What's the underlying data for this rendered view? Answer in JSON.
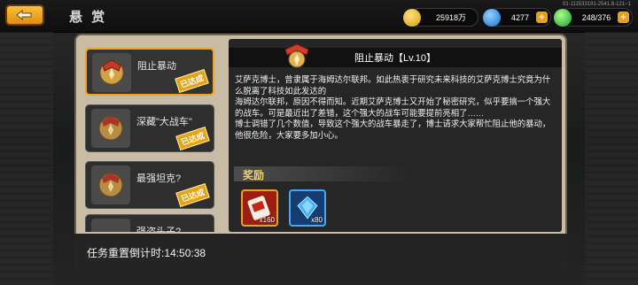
{
  "header": {
    "title": "悬 赏",
    "top_id": "01-111533191-2541.8-121~1"
  },
  "stats": {
    "gold": {
      "value": "25918万",
      "icon": "gold-coin-icon",
      "color": "#f2c12e"
    },
    "gems": {
      "value": "4277",
      "icon": "blue-gem-icon",
      "color": "#2f9be8"
    },
    "energy": {
      "value": "248/376",
      "icon": "green-crystal-icon",
      "color": "#4fd34f"
    }
  },
  "tasks": [
    {
      "label": "阻止暴动",
      "status": "已达成",
      "selected": true
    },
    {
      "label": "深藏\"大战车\"",
      "status": "已达成",
      "selected": false
    },
    {
      "label": "最强坦克?",
      "status": "已达成",
      "selected": false
    },
    {
      "label": "强盗头子?",
      "status": "",
      "selected": false
    }
  ],
  "detail": {
    "title": "阻止暴动【Lv.10】",
    "description": [
      "艾萨克博士，曾隶属于海姆达尔联邦。如此热衷于研究未来科技的艾萨克博士究竟为什么脱离了科技如此发达的",
      "海姆达尔联邦，原因不得而知。近期艾萨克博士又开始了秘密研究，似乎要搞一个强大的战车。可是最近出了差错，这个强大的战车可能要提前亮相了……",
      "博士调错了几个数值，导致这个强大的战车暴走了，博士请求大家帮忙阻止他的暴动，他很危险，大家要多加小心。"
    ],
    "reward_label": "奖励",
    "rewards": [
      {
        "icon": "scroll-ticket-icon",
        "qty": "x160"
      },
      {
        "icon": "blue-crystal-icon",
        "qty": "x80"
      }
    ]
  },
  "footer": {
    "countdown": "任务重置倒计时:14:50:38"
  }
}
